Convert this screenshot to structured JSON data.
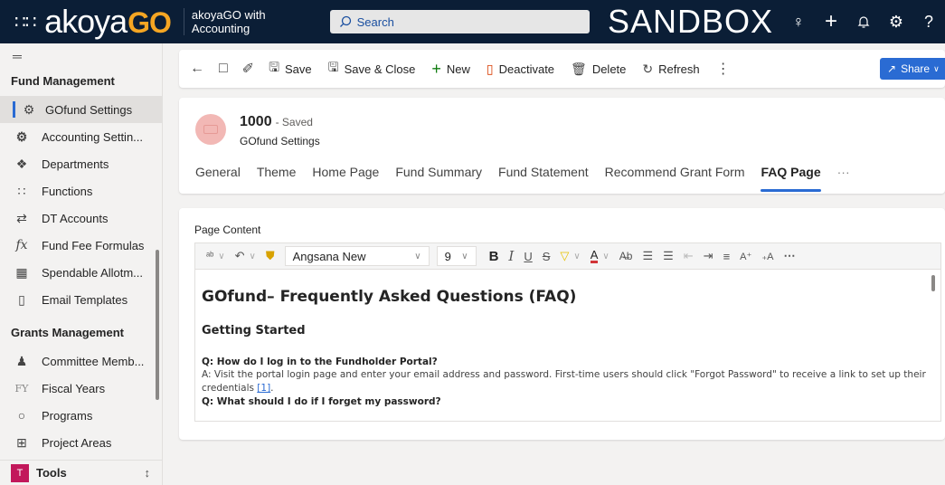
{
  "topbar": {
    "logo_main": "akoya",
    "logo_go": "GO",
    "app_name": "akoyaGO with Accounting",
    "search_placeholder": "Search",
    "environment": "SANDBOX"
  },
  "sidebar": {
    "section1": "Fund Management",
    "items1": [
      {
        "label": "GOfund Settings",
        "icon": "gear-icon",
        "selected": true
      },
      {
        "label": "Accounting Settin...",
        "icon": "gear-icon"
      },
      {
        "label": "Departments",
        "icon": "departments-icon"
      },
      {
        "label": "Functions",
        "icon": "functions-icon"
      },
      {
        "label": "DT Accounts",
        "icon": "transfer-icon"
      },
      {
        "label": "Fund Fee Formulas",
        "icon": "fx-icon"
      },
      {
        "label": "Spendable Allotm...",
        "icon": "grid-icon"
      },
      {
        "label": "Email Templates",
        "icon": "document-icon"
      }
    ],
    "section2": "Grants Management",
    "items2": [
      {
        "label": "Committee Memb...",
        "icon": "people-icon"
      },
      {
        "label": "Fiscal Years",
        "icon": "fy-icon"
      },
      {
        "label": "Programs",
        "icon": "circle-icon"
      },
      {
        "label": "Project Areas",
        "icon": "grid-icon"
      }
    ],
    "tools_badge": "T",
    "tools_label": "Tools"
  },
  "commands": {
    "save": "Save",
    "save_close": "Save & Close",
    "new": "New",
    "deactivate": "Deactivate",
    "delete": "Delete",
    "refresh": "Refresh",
    "share": "Share"
  },
  "record": {
    "title": "1000",
    "status": "- Saved",
    "entity": "GOfund Settings",
    "tabs": [
      "General",
      "Theme",
      "Home Page",
      "Fund Summary",
      "Fund Statement",
      "Recommend Grant Form",
      "FAQ Page",
      "···"
    ],
    "active_tab": "FAQ Page"
  },
  "editor": {
    "field_label": "Page Content",
    "font": "Angsana New",
    "size": "9",
    "heading": "GOfund– Frequently Asked Questions (FAQ)",
    "subheading": "Getting Started",
    "q1": "Q: How do I log in to the Fundholder Portal?",
    "a1": "A: Visit the portal login page and enter your email address and password. First-time users should click \"Forgot Password\" to receive a link to set up their credentials ",
    "a1_ref": "[1]",
    "a1_end": ".",
    "q2": "Q: What should I do if I forget my password?"
  },
  "colors": {
    "topbar": "#0b1e36",
    "accent": "#2a6bd3",
    "logo_go": "#f5a623"
  }
}
